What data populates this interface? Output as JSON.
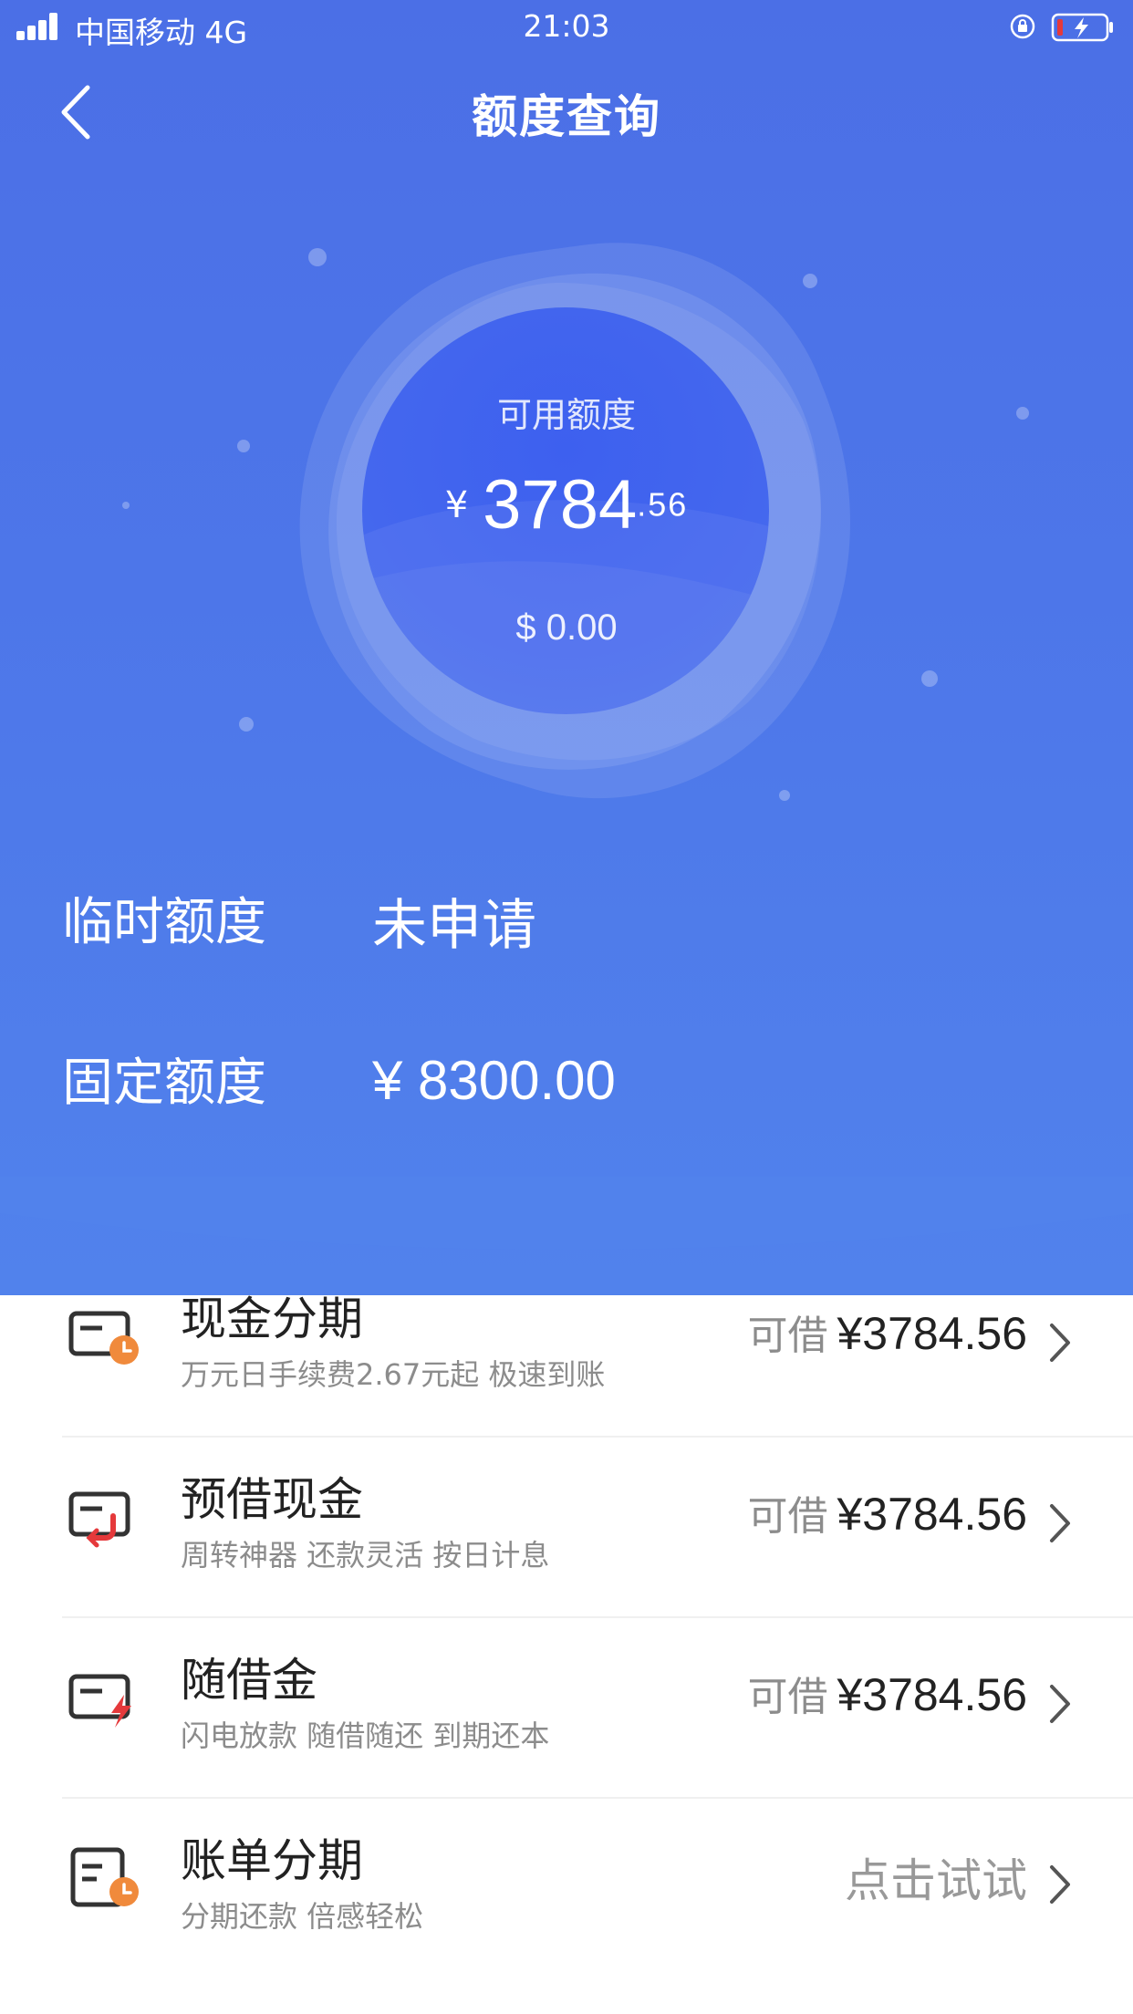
{
  "status_bar": {
    "carrier": "中国移动 4G",
    "time": "21:03"
  },
  "nav": {
    "title": "额度查询"
  },
  "credit": {
    "label": "可用额度",
    "currency": "¥",
    "amount_int": "3784",
    "amount_dec": ".56",
    "usd": "$ 0.00"
  },
  "quota": {
    "temporary": {
      "label": "临时额度",
      "value": "未申请"
    },
    "fixed": {
      "label": "固定额度",
      "value": "¥ 8300.00"
    }
  },
  "products": [
    {
      "title": "现金分期",
      "subtitle": "万元日手续费2.67元起 极速到账",
      "prefix": "可借",
      "amount": "¥3784.56",
      "icon": "card-clock-icon"
    },
    {
      "title": "预借现金",
      "subtitle": "周转神器 还款灵活 按日计息",
      "prefix": "可借",
      "amount": "¥3784.56",
      "icon": "card-loop-icon"
    },
    {
      "title": "随借金",
      "subtitle": "闪电放款 随借随还 到期还本",
      "prefix": "可借",
      "amount": "¥3784.56",
      "icon": "card-lightning-icon"
    },
    {
      "title": "账单分期",
      "subtitle": "分期还款 倍感轻松",
      "action": "点击试试",
      "icon": "bill-clock-icon"
    }
  ],
  "colors": {
    "hero_blue": "#4b6fe6",
    "accent_orange": "#f08a3c",
    "accent_red": "#e5393b",
    "icon_dark": "#333333"
  }
}
